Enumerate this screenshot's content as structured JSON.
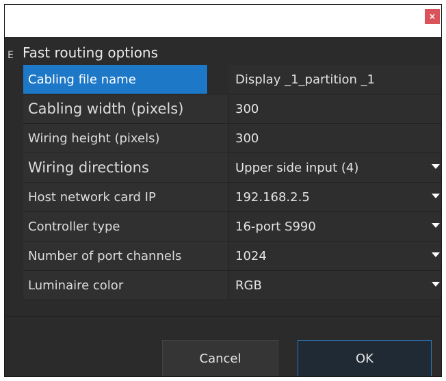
{
  "titlebar": {
    "close_label": "×"
  },
  "group": {
    "marker": "E",
    "title": "Fast routing options"
  },
  "properties": [
    {
      "label": "Cabling file name",
      "value": "Display _1_partition _1",
      "dropdown": false
    },
    {
      "label": "Cabling width (pixels)",
      "value": "300",
      "dropdown": false
    },
    {
      "label": "Wiring height (pixels)",
      "value": "300",
      "dropdown": false
    },
    {
      "label": "Wiring directions",
      "value": "Upper side input (4)",
      "dropdown": true
    },
    {
      "label": "Host network card IP",
      "value": "192.168.2.5",
      "dropdown": true
    },
    {
      "label": "Controller type",
      "value": "16-port S990",
      "dropdown": true
    },
    {
      "label": "Number of port channels",
      "value": "1024",
      "dropdown": true
    },
    {
      "label": "Luminaire color",
      "value": "RGB",
      "dropdown": true
    }
  ],
  "buttons": {
    "cancel": "Cancel",
    "ok": "OK"
  },
  "colors": {
    "selection": "#1e78c8",
    "close": "#d9535a",
    "ok_border": "#2e7fc4"
  }
}
